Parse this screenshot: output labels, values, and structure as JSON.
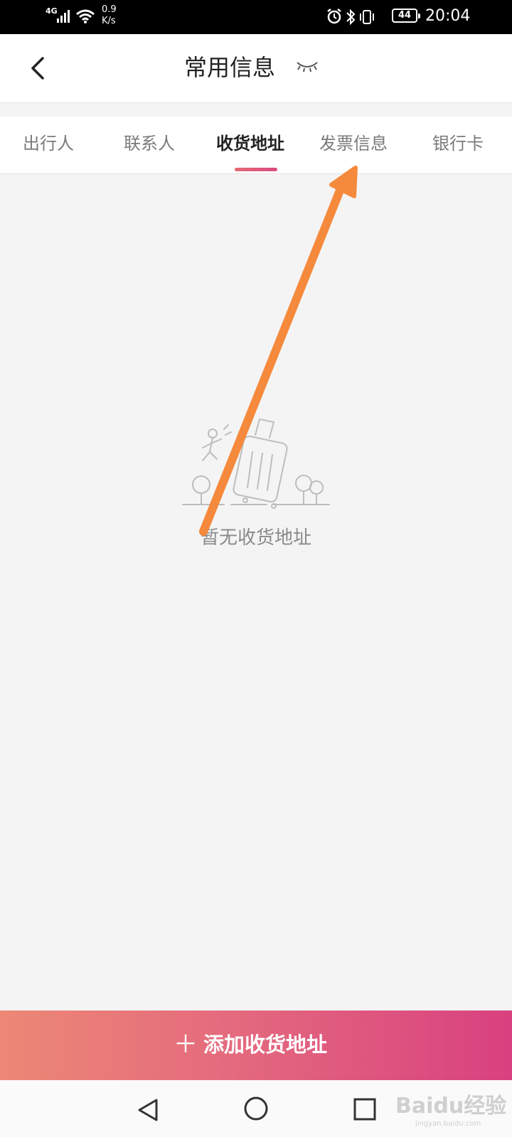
{
  "status_bar": {
    "network": "4G",
    "speed_value": "0.9",
    "speed_unit": "K/s",
    "battery": "44",
    "time": "20:04"
  },
  "header": {
    "title": "常用信息"
  },
  "tabs": [
    {
      "label": "出行人",
      "active": false
    },
    {
      "label": "联系人",
      "active": false
    },
    {
      "label": "收货地址",
      "active": true
    },
    {
      "label": "发票信息",
      "active": false
    },
    {
      "label": "银行卡",
      "active": false
    }
  ],
  "empty_state": {
    "message": "暂无收货地址"
  },
  "add_button": {
    "icon": "plus-icon",
    "label": "添加收货地址"
  },
  "watermark": {
    "logo_text": "Baidu经验",
    "url": "jingyan.baidu.com"
  },
  "colors": {
    "accent_start": "#ec8875",
    "accent_end": "#d8417f",
    "annotation_arrow": "#f5893c"
  }
}
